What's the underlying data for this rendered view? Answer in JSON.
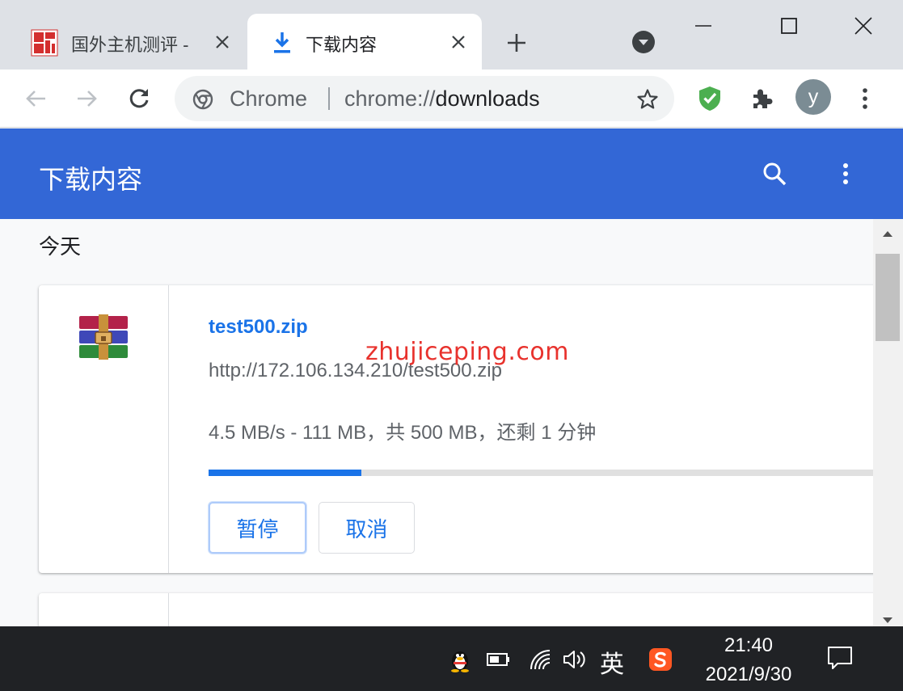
{
  "tabs": [
    {
      "title": "国外主机测评 - ",
      "active": false
    },
    {
      "title": "下载内容",
      "active": true
    }
  ],
  "omnibox": {
    "chip": "Chrome",
    "url_scheme": "chrome://",
    "url_host": "downloads"
  },
  "profile": {
    "initial": "y"
  },
  "downloads_page": {
    "title": "下载内容",
    "section_label": "今天",
    "items": [
      {
        "file_name": "test500.zip",
        "url": "http://172.106.134.210/test500.zip",
        "status": "4.5 MB/s - 111 MB，共 500 MB，还剩 1 分钟",
        "progress_fraction": 0.222,
        "pause_label": "暂停",
        "cancel_label": "取消"
      }
    ]
  },
  "watermark": "zhujiceping.com",
  "taskbar": {
    "ime": "英",
    "time": "21:40",
    "date": "2021/9/30"
  },
  "colors": {
    "header_blue": "#3367d6",
    "link_blue": "#1a73e8",
    "watermark_red": "#e8322d"
  }
}
